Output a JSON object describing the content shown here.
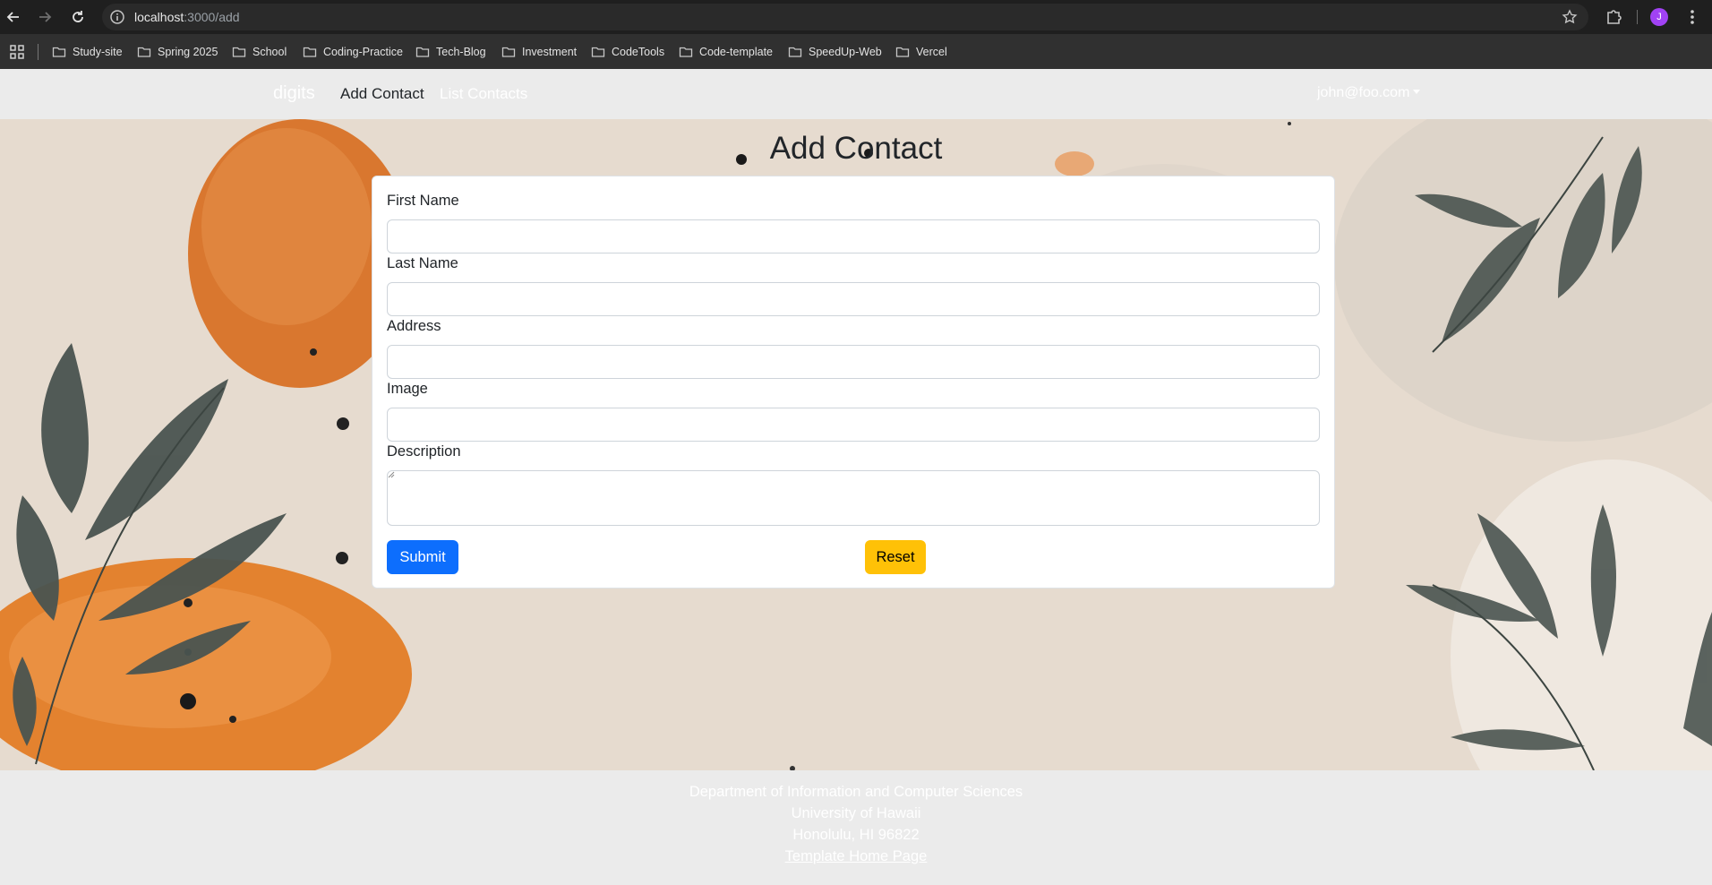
{
  "browser": {
    "url_host": "localhost",
    "url_path": ":3000/add",
    "profile_initial": "J",
    "bookmarks": [
      "Study-site",
      "Spring 2025",
      "School",
      "Coding-Practice",
      "Tech-Blog",
      "Investment",
      "CodeTools",
      "Code-template",
      "SpeedUp-Web",
      "Vercel"
    ]
  },
  "navbar": {
    "brand": "digits",
    "links": [
      "Add Contact",
      "List Contacts"
    ],
    "active_link": "Add Contact",
    "user": "john@foo.com"
  },
  "form": {
    "title": "Add Contact",
    "fields": [
      {
        "label": "First Name",
        "value": ""
      },
      {
        "label": "Last Name",
        "value": ""
      },
      {
        "label": "Address",
        "value": ""
      },
      {
        "label": "Image",
        "value": ""
      },
      {
        "label": "Description",
        "value": ""
      }
    ],
    "submit_label": "Submit",
    "reset_label": "Reset"
  },
  "footer": {
    "lines": [
      "Department of Information and Computer Sciences",
      "University of Hawaii",
      "Honolulu, HI 96822"
    ],
    "link": "Template Home Page"
  },
  "colors": {
    "primary": "#0d6efd",
    "warning": "#ffc107",
    "navbar_bg": "#ebebeb",
    "chrome_bg": "#1f1f1f"
  }
}
